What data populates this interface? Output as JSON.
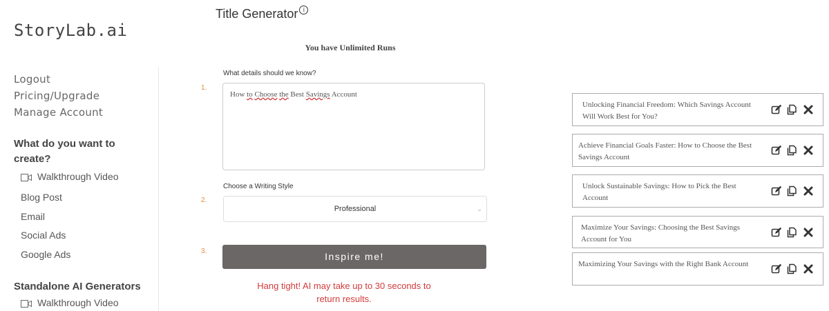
{
  "sidebar": {
    "logo": "StoryLab.ai",
    "links": [
      "Logout",
      "Pricing/Upgrade",
      "Manage Account"
    ],
    "create_heading_line1": "What do you want to",
    "create_heading_line2": "create?",
    "create_items": [
      "Walkthrough Video",
      "Blog Post",
      "Email",
      "Social Ads",
      "Google Ads"
    ],
    "standalone_heading": "Standalone AI Generators",
    "standalone_items": [
      "Walkthrough Video"
    ]
  },
  "main": {
    "title": "Title Generator",
    "runs_notice": "You have Unlimited Runs",
    "step1": {
      "number": "1.",
      "label": "What details should we know?",
      "value_parts": [
        "How ",
        "to",
        " ",
        "Choose",
        " ",
        "the",
        " Best ",
        "Savings",
        " Account"
      ]
    },
    "step2": {
      "number": "2.",
      "label": "Choose a Writing Style",
      "selected": "Professional"
    },
    "step3": {
      "number": "3.",
      "button": "Inspire me!"
    },
    "wait_line1": "Hang tight! AI may take up to 30 seconds to",
    "wait_line2": "return results."
  },
  "results": [
    {
      "text": "Unlocking Financial Freedom: Which Savings Account Will Work Best for You?"
    },
    {
      "text": "Achieve Financial Goals Faster: How to Choose the Best Savings Account"
    },
    {
      "text": "Unlock Sustainable Savings: How to Pick the Best Account"
    },
    {
      "text": "Maximize Your Savings: Choosing the Best Savings Account for You"
    },
    {
      "text": "Maximizing Your Savings with the Right Bank Account"
    }
  ],
  "colors": {
    "step_number": "#e08a3c",
    "button_bg": "#6b6766",
    "wait_text": "#d33b3b"
  },
  "icons": {
    "edit": "edit-icon",
    "copy": "copy-icon",
    "delete": "close-icon",
    "video": "video-camera-icon",
    "info": "info-icon"
  }
}
